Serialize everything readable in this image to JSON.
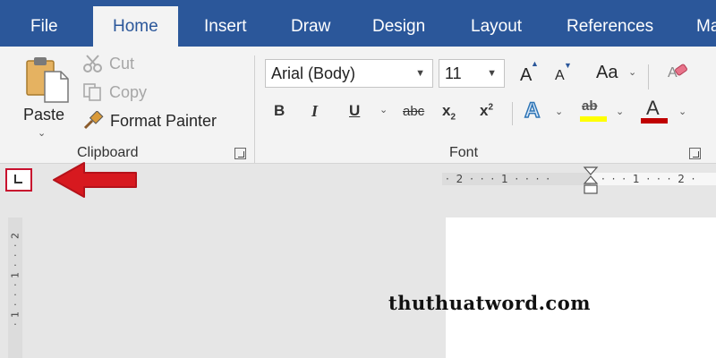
{
  "tabs": [
    {
      "label": "File"
    },
    {
      "label": "Home"
    },
    {
      "label": "Insert"
    },
    {
      "label": "Draw"
    },
    {
      "label": "Design"
    },
    {
      "label": "Layout"
    },
    {
      "label": "References"
    },
    {
      "label": "Ma"
    }
  ],
  "clipboard": {
    "paste": "Paste",
    "cut": "Cut",
    "copy": "Copy",
    "format_painter": "Format Painter",
    "group_label": "Clipboard"
  },
  "font": {
    "font_name": "Arial (Body)",
    "font_size": "11",
    "change_case": "Aa",
    "group_label": "Font",
    "bold": "B",
    "italic": "I",
    "underline": "U",
    "strikethrough": "abc",
    "subscript": "x",
    "subscript_mark": "2",
    "superscript": "x",
    "superscript_mark": "2",
    "grow": "A",
    "shrink": "A",
    "effects": "A",
    "highlight": "ab",
    "color": "A"
  },
  "ruler": {
    "horizontal": "· 2 · · · 1 · · · ·",
    "horizontal_right": "· · · 1 · · · 2 ·",
    "vertical": [
      "2",
      "·",
      "·",
      "·",
      "1",
      "·",
      "·",
      "·",
      "1",
      "·"
    ]
  },
  "watermark": "thuthuatword.com",
  "colors": {
    "tab_bar": "#2b579a",
    "ribbon": "#f3f3f3",
    "arrow": "#d7191f",
    "highlight": "#ffff00",
    "font_color": "#c00000"
  }
}
